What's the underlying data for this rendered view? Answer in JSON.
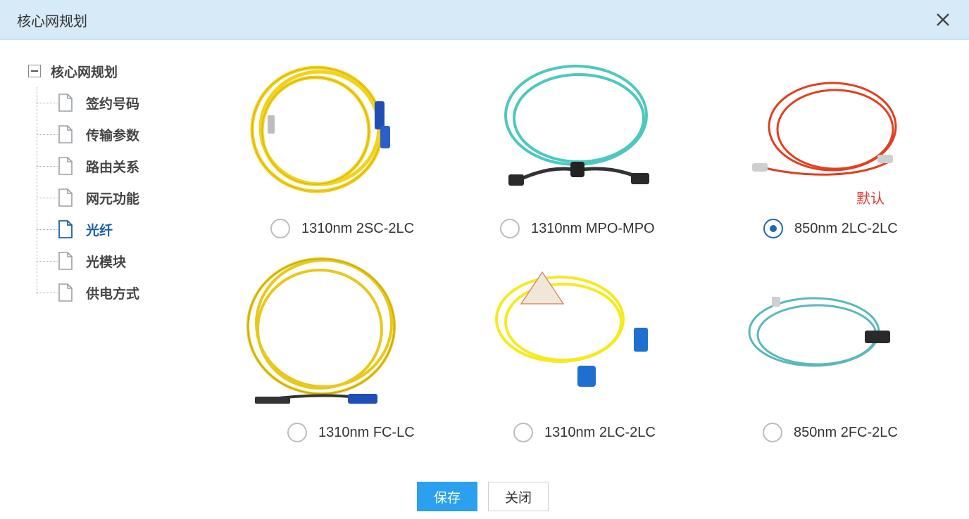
{
  "dialog": {
    "title": "核心网规划",
    "close_icon": "close-icon"
  },
  "tree": {
    "root_label": "核心网规划",
    "items": [
      {
        "label": "签约号码",
        "active": false
      },
      {
        "label": "传输参数",
        "active": false
      },
      {
        "label": "路由关系",
        "active": false
      },
      {
        "label": "网元功能",
        "active": false
      },
      {
        "label": "光纤",
        "active": true
      },
      {
        "label": "光模块",
        "active": false
      },
      {
        "label": "供电方式",
        "active": false
      }
    ]
  },
  "options": [
    {
      "label": "1310nm 2SC-2LC",
      "selected": false,
      "cable_color": "#f2d21c"
    },
    {
      "label": "1310nm MPO-MPO",
      "selected": false,
      "cable_color": "#4cc8c0"
    },
    {
      "label": "850nm 2LC-2LC",
      "selected": true,
      "cable_color": "#e0401f",
      "tag": "默认"
    },
    {
      "label": "1310nm FC-LC",
      "selected": false,
      "cable_color": "#e8c81a"
    },
    {
      "label": "1310nm 2LC-2LC",
      "selected": false,
      "cable_color": "#f5ea22"
    },
    {
      "label": "850nm 2FC-2LC",
      "selected": false,
      "cable_color": "#5ab8bb"
    }
  ],
  "buttons": {
    "save": "保存",
    "close": "关闭"
  },
  "colors": {
    "accent": "#2166b3",
    "save_button": "#2aa0ee",
    "title_bar": "#d6eaf8",
    "default_tag": "#e53935"
  }
}
